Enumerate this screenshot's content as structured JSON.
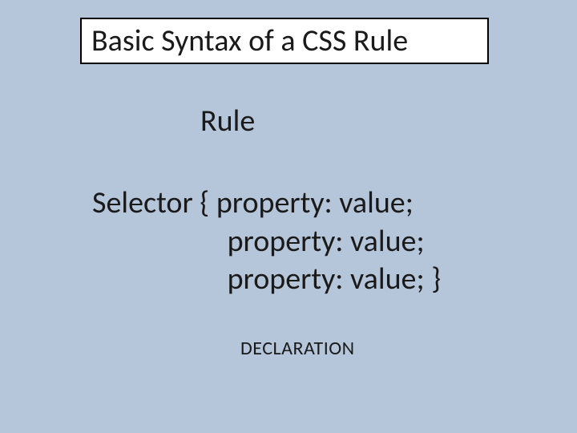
{
  "title": "Basic Syntax of a CSS Rule",
  "rule_label": "Rule",
  "syntax": {
    "line1_left": "Selector { ",
    "line1_right": "property: value;",
    "line2": "property: value;",
    "line3": "property: value; }"
  },
  "declaration_label": "DECLARATION"
}
